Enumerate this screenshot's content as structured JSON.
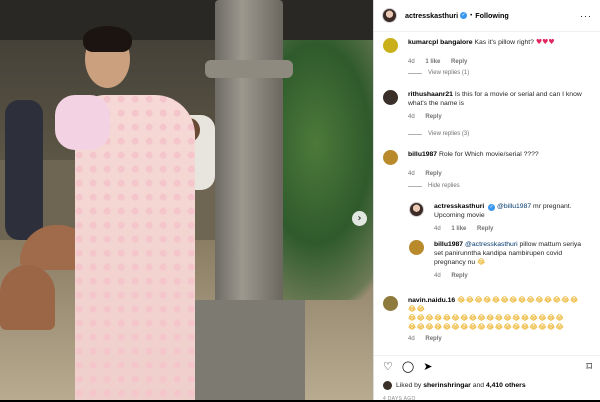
{
  "post": {
    "photo_alt": "post-photo",
    "next_arrow": "›"
  },
  "header": {
    "username": "actresskasthuri",
    "verified_mark": "✓",
    "separator": "•",
    "follow_status": "Following",
    "more_glyph": "···"
  },
  "comments": [
    {
      "username": "kumarcpl bangalore",
      "text": "Kas it's pillow right?",
      "hearts": "♥♥♥",
      "age": "4d",
      "likes": "1 like",
      "reply": "Reply",
      "view_replies": "View replies (1)"
    },
    {
      "username": "rithushaanr21",
      "text": "Is this for a movie or serial and can I know what's the name is",
      "age": "4d",
      "reply": "Reply",
      "view_replies": "View replies (3)"
    },
    {
      "username": "billu1987",
      "text": "Role for Which movie/serial ????",
      "age": "4d",
      "reply": "Reply",
      "hide_replies": "Hide replies",
      "replies": [
        {
          "username": "actresskasthuri",
          "mention": "@billu1987",
          "text": "mr pregnant. Upcoming movie",
          "age": "4d",
          "likes": "1 like",
          "reply": "Reply"
        },
        {
          "username": "billu1987",
          "mention": "@actresskasthuri",
          "text": "pillow mattum seriya set panirunntha kandipa nambirupen covid pregnancy nu",
          "emoji": "😂",
          "age": "4d",
          "reply": "Reply"
        }
      ]
    },
    {
      "username": "navin.naidu.16",
      "emoji_line1": "😂😂😂😂😂😂😂😂😂😂😂😂😂😂😂😂",
      "emoji_line2": "😂😂😂😂😂😂😂😂😂😂😂😂😂😂😂😂😂😂",
      "emoji_line3": "😂😂😂😂😂😂😂😂😂😂😂😂😂😂😂😂😂😂",
      "age": "4d",
      "reply": "Reply"
    }
  ],
  "actions": {
    "like_icon": "♡",
    "comment_icon": "◯",
    "share_icon": "➤",
    "save_icon": "⌑"
  },
  "likes": {
    "prefix": "Liked by",
    "user": "sherinshringar",
    "conjunction": "and",
    "others": "4,410 others"
  },
  "timestamp": "4 DAYS AGO"
}
